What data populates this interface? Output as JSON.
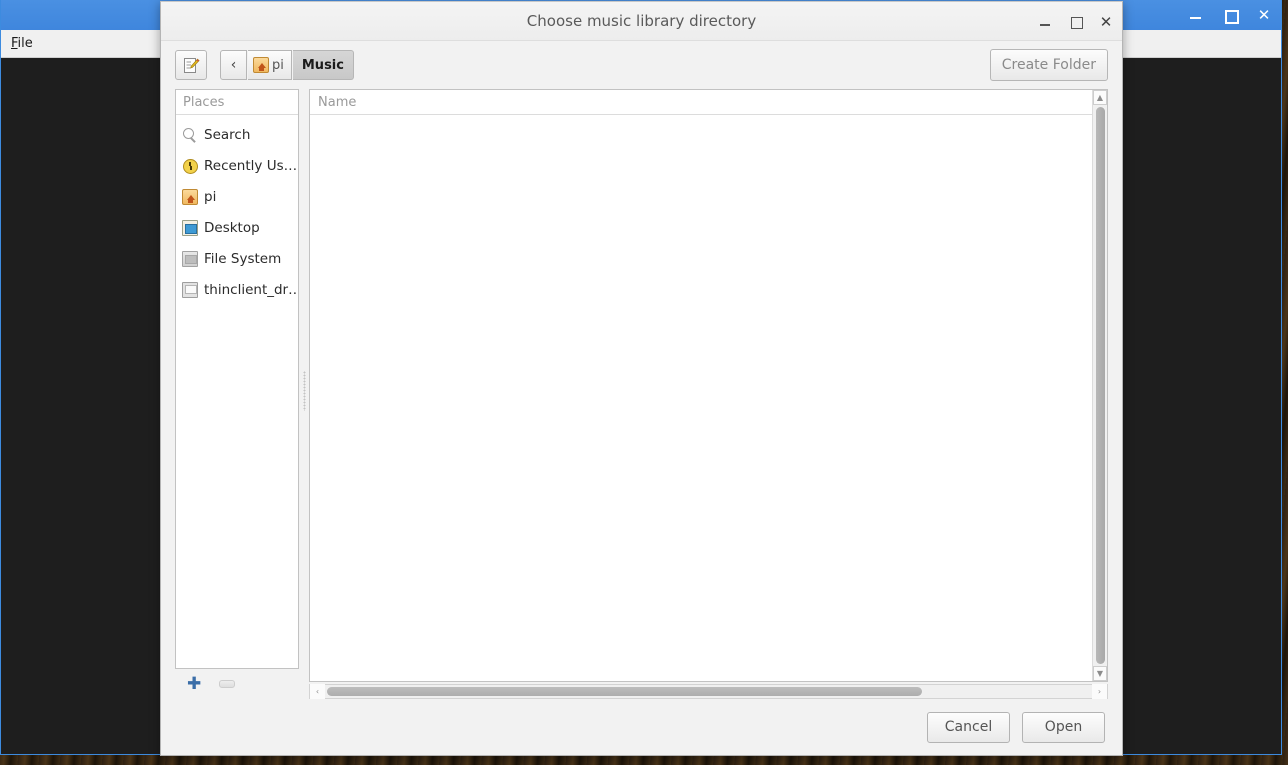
{
  "background_window": {
    "menu": {
      "file_label": "File",
      "file_accesskey": "F",
      "file_rest": "ile"
    },
    "controls": {
      "minimize": "minimize-icon",
      "maximize": "maximize-icon",
      "close": "close-icon",
      "close_glyph": "✕"
    },
    "titlebar_color": "#4a90e2",
    "content_color": "#1e1e1e"
  },
  "dialog": {
    "title": "Choose music library directory",
    "controls": {
      "minimize": "minimize-icon",
      "maximize": "maximize-icon",
      "close": "close-icon",
      "close_glyph": "✕"
    },
    "toolbar": {
      "location_button": "type-a-file-name-icon",
      "back_glyph": "‹",
      "breadcrumbs": [
        {
          "label": "pi",
          "icon": "home-folder-icon",
          "active": false
        },
        {
          "label": "Music",
          "icon": "",
          "active": true
        }
      ],
      "create_folder_label": "Create Folder"
    },
    "places": {
      "header": "Places",
      "items": [
        {
          "label": "Search",
          "icon": "search-icon"
        },
        {
          "label": "Recently Us…",
          "icon": "recent-clock-icon"
        },
        {
          "label": "pi",
          "icon": "home-folder-icon"
        },
        {
          "label": "Desktop",
          "icon": "desktop-icon"
        },
        {
          "label": "File System",
          "icon": "drive-icon"
        },
        {
          "label": "thinclient_dr…",
          "icon": "thinclient-drive-icon"
        }
      ],
      "add_glyph": "✚",
      "add_name": "add-bookmark-button",
      "remove_name": "remove-bookmark-button"
    },
    "files": {
      "column_header": "Name",
      "rows": [],
      "vscroll_up_glyph": "▲",
      "vscroll_down_glyph": "▼",
      "hscroll_left_glyph": "‹",
      "hscroll_right_glyph": "›"
    },
    "footer": {
      "cancel_label": "Cancel",
      "open_label": "Open"
    }
  }
}
